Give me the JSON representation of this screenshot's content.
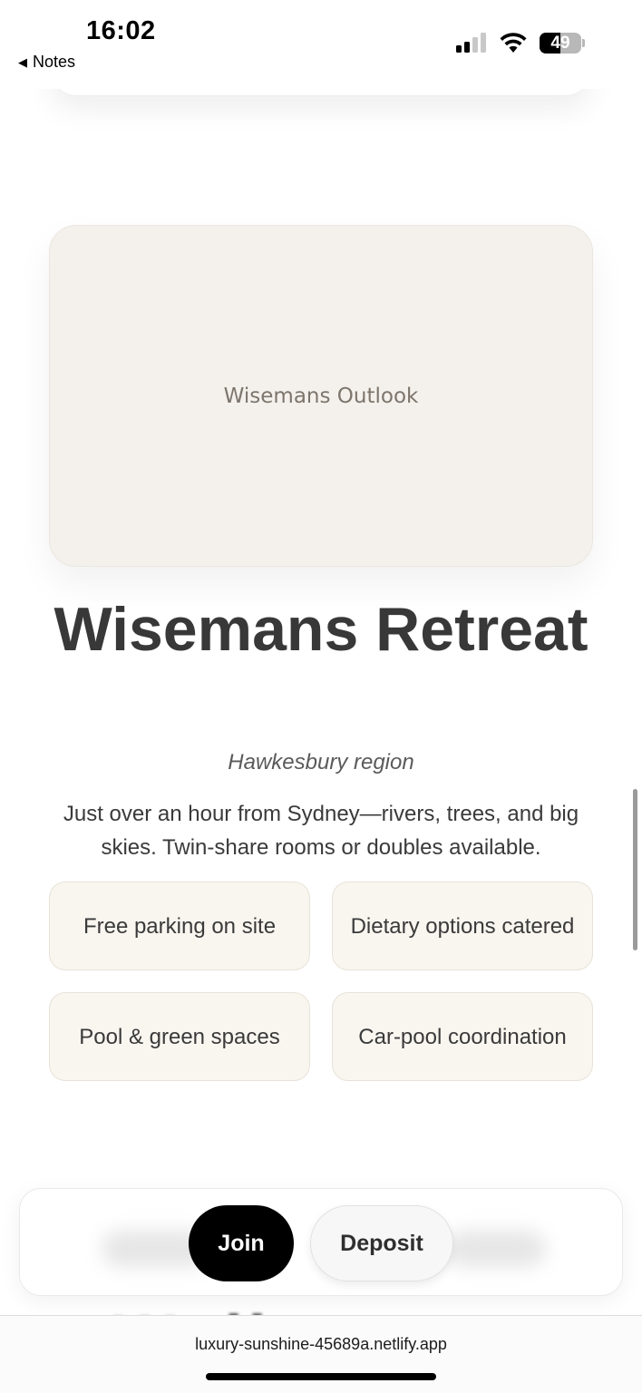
{
  "status_bar": {
    "time": "16:02",
    "back_label": "Notes",
    "back_icon": "back-triangle-icon",
    "battery_level": "49",
    "battery_fraction": 0.49
  },
  "hero": {
    "image_label": "Wisemans Outlook",
    "background_color": "#f4f1ed"
  },
  "venue": {
    "title": "Wisemans Retreat",
    "region": "Hawkesbury region",
    "description": "Just over an hour from Sydney—rivers, trees, and big skies. Twin-share rooms or doubles available.",
    "features": [
      "Free parking on site",
      "Dietary options catered",
      "Pool & green spaces",
      "Car-pool coordination"
    ]
  },
  "actions": {
    "join_label": "Join",
    "deposit_label": "Deposit",
    "join_color": "#000000"
  },
  "browser": {
    "url": "luxury-sunshine-45689a.netlify.app"
  }
}
